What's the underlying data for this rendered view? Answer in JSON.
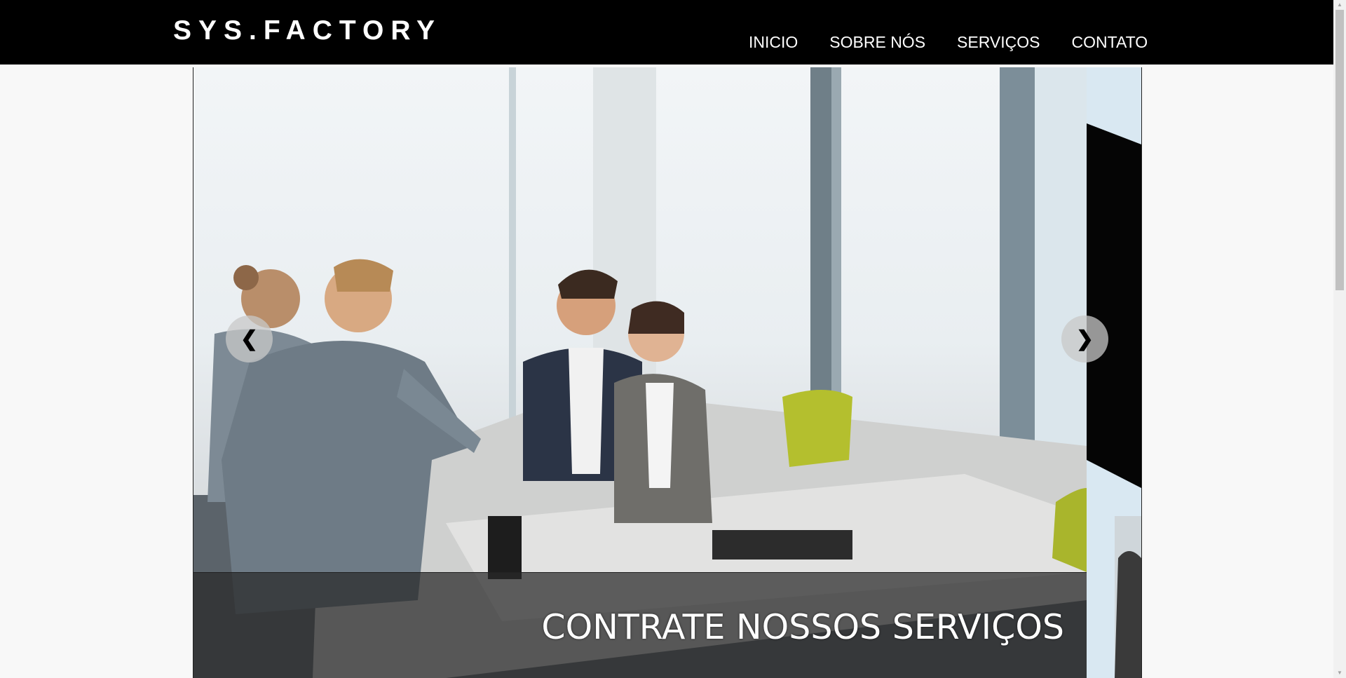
{
  "header": {
    "logo": "SYS.FACTORY",
    "nav": [
      "INICIO",
      "SOBRE NÓS",
      "SERVIÇOS",
      "CONTATO"
    ]
  },
  "slider": {
    "caption": "CONTRATE NOSSOS SERVIÇOS",
    "prev_icon": "chevron-left-icon",
    "next_icon": "chevron-right-icon"
  },
  "colors": {
    "header_bg": "#000000",
    "page_bg": "#f8f8f8",
    "caption_bg": "#282828"
  }
}
